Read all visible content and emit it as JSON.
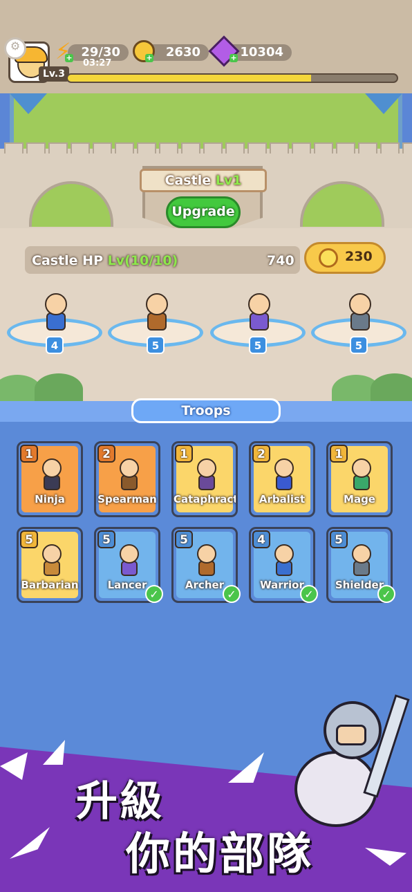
{
  "hud": {
    "energy": "29/30",
    "energy_timer": "03:27",
    "gold": "2630",
    "gems": "10304",
    "player_level": "Lv.3",
    "xp_fraction": 0.74
  },
  "castle": {
    "title": "Castle ",
    "level": "Lv1",
    "upgrade_label": "Upgrade",
    "hp_label": "Castle HP ",
    "hp_level": "Lv(10/10)",
    "hp_value": "740",
    "hp_upgrade_cost": "230"
  },
  "deployed_heroes": [
    {
      "name": "Warrior",
      "level": "4",
      "color": "#3a6fd0"
    },
    {
      "name": "Archer",
      "level": "5",
      "color": "#b06a2c"
    },
    {
      "name": "Lancer",
      "level": "5",
      "color": "#7a5ad0"
    },
    {
      "name": "Shielder",
      "level": "5",
      "color": "#6a7a8a"
    }
  ],
  "troops": {
    "header": "Troops",
    "cards": [
      {
        "name": "Ninja",
        "count": "1",
        "rarity": "orange",
        "owned": false,
        "color": "#3b3b55"
      },
      {
        "name": "Spearman",
        "count": "2",
        "rarity": "orange",
        "owned": false,
        "color": "#8a5a2c"
      },
      {
        "name": "Cataphract",
        "count": "1",
        "rarity": "yellow",
        "owned": false,
        "color": "#6a4a9a"
      },
      {
        "name": "Arbalist",
        "count": "2",
        "rarity": "yellow",
        "owned": false,
        "color": "#3a5ad0"
      },
      {
        "name": "Mage",
        "count": "1",
        "rarity": "yellow",
        "owned": false,
        "color": "#3aa86a"
      },
      {
        "name": "Barbarian",
        "count": "5",
        "rarity": "yellow",
        "owned": false,
        "color": "#c88a3a"
      },
      {
        "name": "Lancer",
        "count": "5",
        "rarity": "blue",
        "owned": true,
        "color": "#7a5ad0"
      },
      {
        "name": "Archer",
        "count": "5",
        "rarity": "blue",
        "owned": true,
        "color": "#b06a2c"
      },
      {
        "name": "Warrior",
        "count": "4",
        "rarity": "blue",
        "owned": true,
        "color": "#3a6fd0"
      },
      {
        "name": "Shielder",
        "count": "5",
        "rarity": "blue",
        "owned": true,
        "color": "#6a7a8a"
      }
    ]
  },
  "promo": {
    "line1": "升級",
    "line2": "你的部隊"
  },
  "icons": {
    "energy": "lightning-icon",
    "gold": "coin-icon",
    "gems": "gem-icon",
    "settings": "gear-icon",
    "owned": "checkmark-icon"
  }
}
